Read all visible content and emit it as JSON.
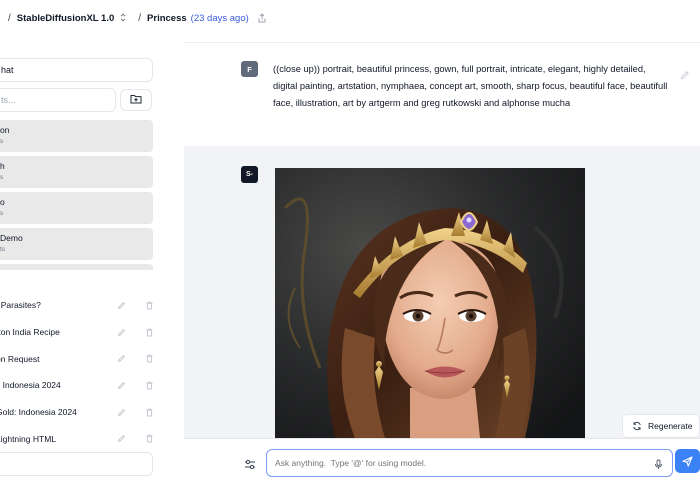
{
  "header": {
    "model_name": "StableDiffusionXL 1.0",
    "chat_title": "Princess",
    "chat_age": "(23 days ago)",
    "icons": {
      "model_dropdown": "chevron-updown-icon",
      "share": "share-icon"
    }
  },
  "sidebar": {
    "new_chat_label": "hat",
    "search_placeholder": "ts...",
    "models": [
      {
        "name": "on",
        "sub": "s"
      },
      {
        "name": "h",
        "sub": "s"
      },
      {
        "name": "o",
        "sub": "s"
      },
      {
        "name": "Demo",
        "sub": "ts"
      }
    ],
    "history": [
      {
        "label": "t Parasites?"
      },
      {
        "label": "tton India Recipe"
      },
      {
        "label": "on Request"
      },
      {
        "label": "s Indonesia 2024"
      },
      {
        "label": "Gold: Indonesia 2024"
      },
      {
        "label": "Lightning HTML"
      }
    ]
  },
  "conversation": {
    "user_avatar": "F",
    "user_prompt": "((close up)) portrait, beautiful princess, gown, full portrait, intricate, elegant, highly detailed, digital painting, artstation, nymphaea, concept art, smooth, sharp focus, beautiful face, beautifull face, illustration, art by artgerm and greg rutkowski and alphonse mucha",
    "assistant_avatar": "S-",
    "regenerate_label": "Regenerate"
  },
  "composer": {
    "placeholder": "Ask anything.  Type '@' for using model."
  },
  "colors": {
    "accent": "#3b82f6",
    "input_border": "#7c9cf5",
    "date_link": "#3b5bdb",
    "assistant_bg": "#f1f3f7",
    "model_item_bg": "#e9e9ea"
  }
}
